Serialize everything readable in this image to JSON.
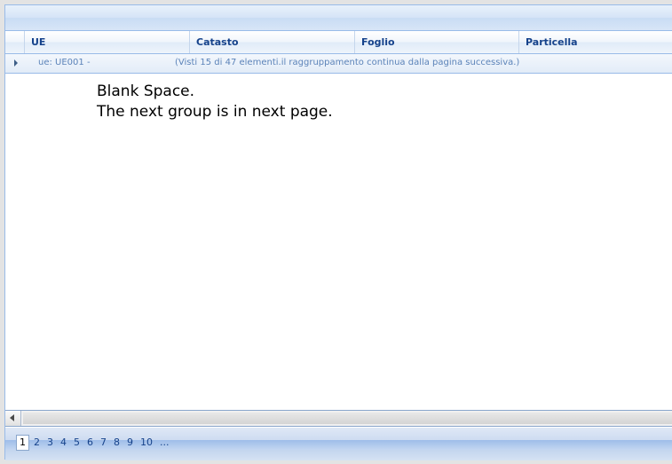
{
  "grid": {
    "columns": [
      {
        "label": "UE"
      },
      {
        "label": "Catasto"
      },
      {
        "label": "Foglio"
      },
      {
        "label": "Particella"
      }
    ],
    "group_row": {
      "label": "ue: UE001 -",
      "note": "(Visti 15 di 47 elementi.il raggruppamento continua dalla pagina successiva.)"
    }
  },
  "annotation": {
    "line1": "Blank Space.",
    "line2": "The next group is in next page."
  },
  "pager": {
    "pages": [
      "1",
      "2",
      "3",
      "4",
      "5",
      "6",
      "7",
      "8",
      "9",
      "10",
      "..."
    ],
    "current": "1"
  },
  "colors": {
    "header_text": "#15428b",
    "border": "#99bbe8",
    "group_text": "#5b83b9"
  }
}
